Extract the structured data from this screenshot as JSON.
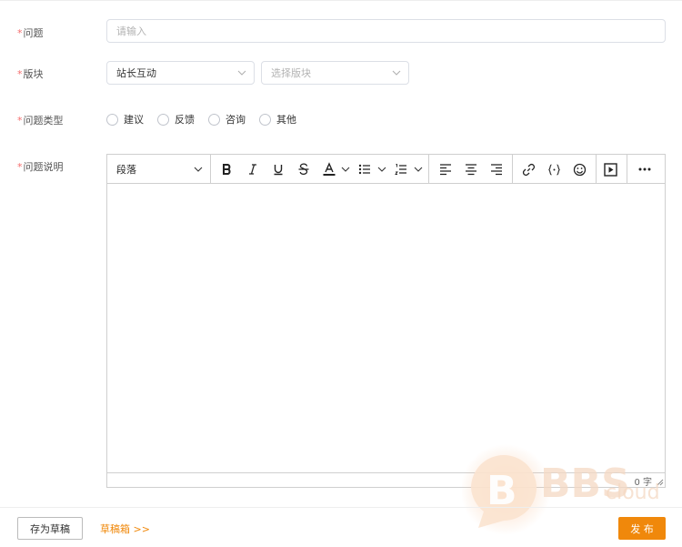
{
  "form": {
    "question": {
      "label": "问题",
      "placeholder": "请输入"
    },
    "section": {
      "label": "版块",
      "selected_value": "站长互动",
      "placeholder": "选择版块"
    },
    "type": {
      "label": "问题类型",
      "options": [
        "建议",
        "反馈",
        "咨询",
        "其他"
      ]
    },
    "description": {
      "label": "问题说明"
    },
    "required_mark": "*"
  },
  "editor": {
    "block_format": "段落",
    "word_count": "0 字",
    "tools": [
      "chevron-down-icon",
      "bold-icon",
      "italic-icon",
      "underline-icon",
      "strikethrough-icon",
      "text-color-icon",
      "bullet-list-icon",
      "numbered-list-icon",
      "align-left-icon",
      "align-center-icon",
      "align-right-icon",
      "link-icon",
      "code-icon",
      "emoji-icon",
      "video-icon",
      "more-icon"
    ]
  },
  "footer": {
    "save_draft_label": "存为草稿",
    "drafts_link": "草稿箱 >>",
    "publish_label": "发 布"
  },
  "watermark": {
    "text": "BBS",
    "subtext": "cloud"
  },
  "colors": {
    "accent": "#f0880b",
    "required": "#f56c6c",
    "border": "#dcdfe6"
  }
}
